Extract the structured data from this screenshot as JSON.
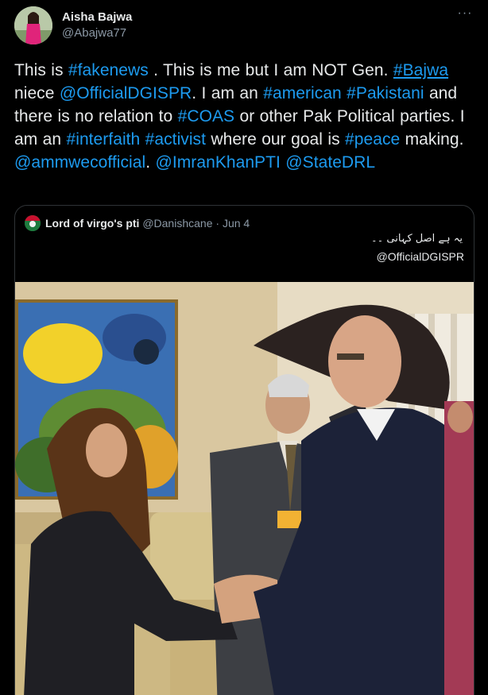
{
  "author": {
    "name": "Aisha Bajwa",
    "handle": "@Abajwa77",
    "more_label": "···"
  },
  "tweet": {
    "t1": "This is ",
    "h_fakenews": "#fakenews",
    "t2": " . This is me but I am NOT Gen. ",
    "h_bajwa": "#Bajwa",
    "t3": " niece ",
    "m_dgispr": "@OfficialDGISPR",
    "t4": ". I am an ",
    "h_american": "#american",
    "t5": " ",
    "h_pakistani": "#Pakistani",
    "t6": " and there is no relation to ",
    "h_coas": "#COAS",
    "t7": " or other Pak Political parties. I am an ",
    "h_interfaith": "#interfaith",
    "t8": " ",
    "h_activist": "#activist",
    "t9": " where our goal is ",
    "h_peace": "#peace",
    "t10": " making.  ",
    "m_ammwec": "@ammwecofficial",
    "t11": ". ",
    "m_imran": "@ImranKhanPTI",
    "t12": " ",
    "m_statedrl": "@StateDRL"
  },
  "quote": {
    "name": "Lord of virgo's pti",
    "handle": "@Danishcane",
    "separator": " · ",
    "date": "Jun 4",
    "urdu_text": "یہ ہے اصل کہانی ۔۔",
    "mention": "@OfficialDGISPR"
  },
  "colors": {
    "background": "#000000",
    "text": "#e7e9ea",
    "secondary": "#8b98a5",
    "link": "#1d9bf0",
    "border": "#2f3336"
  }
}
